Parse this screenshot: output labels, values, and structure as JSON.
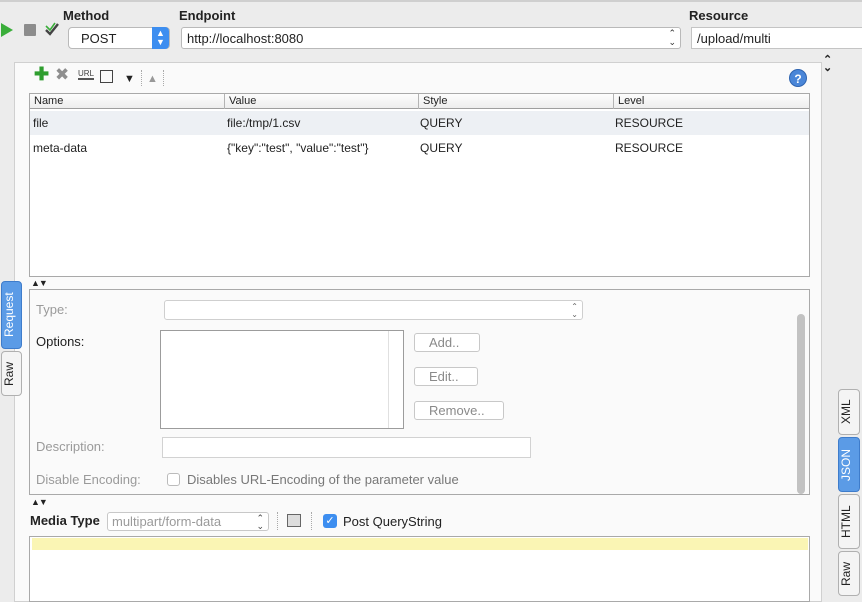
{
  "topbar": {
    "method_label": "Method",
    "method_value": "POST",
    "endpoint_label": "Endpoint",
    "endpoint_value": "http://localhost:8080",
    "resource_label": "Resource",
    "resource_value": "/upload/multi"
  },
  "table": {
    "columns": [
      "Name",
      "Value",
      "Style",
      "Level"
    ],
    "rows": [
      {
        "name": "file",
        "value": "file:/tmp/1.csv",
        "style": "QUERY",
        "level": "RESOURCE"
      },
      {
        "name": "meta-data",
        "value": "{\"key\":\"test\", \"value\":\"test\"}",
        "style": "QUERY",
        "level": "RESOURCE"
      }
    ]
  },
  "form": {
    "type_label": "Type:",
    "options_label": "Options:",
    "add_label": "Add..",
    "edit_label": "Edit..",
    "remove_label": "Remove..",
    "description_label": "Description:",
    "disable_encoding_label": "Disable Encoding:",
    "disable_encoding_text": "Disables URL-Encoding of the parameter value"
  },
  "media": {
    "label": "Media Type",
    "value": "multipart/form-data",
    "post_querystring_label": "Post QueryString",
    "post_querystring_checked": true
  },
  "left_tabs": {
    "request": "Request",
    "raw": "Raw"
  },
  "right_tabs": {
    "xml": "XML",
    "json": "JSON",
    "html": "HTML",
    "raw": "Raw"
  },
  "colors": {
    "accent": "#3d8ef0",
    "add_green": "#2f9e2f",
    "highlight_line": "#faf5b4"
  }
}
